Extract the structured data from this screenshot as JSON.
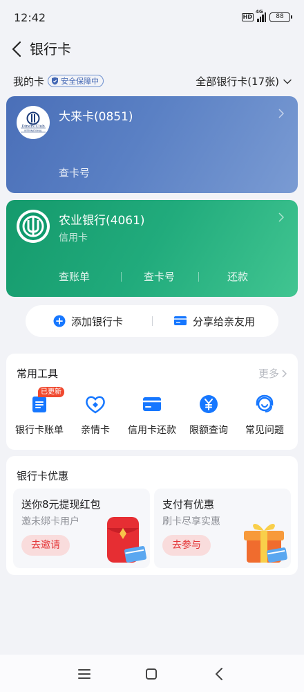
{
  "status_bar": {
    "time": "12:42",
    "hd": "HD",
    "network": "4G",
    "battery": "88"
  },
  "header": {
    "title": "银行卡"
  },
  "cards_section": {
    "my_cards_label": "我的卡",
    "safety_badge": "安全保障中",
    "all_cards": "全部银行卡(17张)"
  },
  "cards": [
    {
      "name": "大来卡(0851)",
      "logo_text": "Diners Club",
      "logo_subtext": "INTERNATIONAL",
      "actions": [
        "查卡号"
      ],
      "color": "#4f74bb"
    },
    {
      "name": "农业银行(4061)",
      "type": "信用卡",
      "actions": [
        "查账单",
        "查卡号",
        "还款"
      ],
      "color": "#1aa174"
    }
  ],
  "card_actions": {
    "add": "添加银行卡",
    "share": "分享给亲友用"
  },
  "tools": {
    "title": "常用工具",
    "more": "更多",
    "badge": "已更新",
    "items": [
      {
        "label": "银行卡账单",
        "icon": "bill-icon"
      },
      {
        "label": "亲情卡",
        "icon": "family-card-icon"
      },
      {
        "label": "信用卡还款",
        "icon": "credit-card-icon"
      },
      {
        "label": "限额查询",
        "icon": "yen-icon"
      },
      {
        "label": "常见问题",
        "icon": "support-icon"
      }
    ]
  },
  "promos": {
    "title": "银行卡优惠",
    "items": [
      {
        "title": "送你8元提现红包",
        "subtitle": "邀未绑卡用户",
        "button": "去邀请",
        "icon": "red-envelope-icon"
      },
      {
        "title": "支付有优惠",
        "subtitle": "刷卡尽享实惠",
        "button": "去参与",
        "icon": "gift-box-icon"
      }
    ]
  },
  "colors": {
    "accent": "#1677ff",
    "promo_button": "#e4383a",
    "badge": "#f0492f"
  }
}
